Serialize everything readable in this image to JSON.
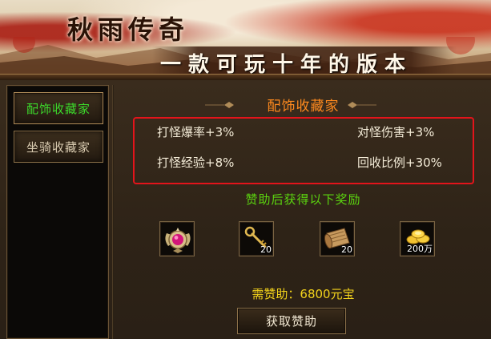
{
  "banner": {
    "title": "秋雨传奇",
    "slogan": "一款可玩十年的版本"
  },
  "sidebar": {
    "items": [
      {
        "label": "配饰收藏家",
        "active": true
      },
      {
        "label": "坐骑收藏家",
        "active": false
      }
    ]
  },
  "panel": {
    "heading": "配饰收藏家",
    "attributes": [
      "打怪爆率+3%",
      "对怪伤害+3%",
      "打怪经验+8%",
      "回收比例+30%"
    ],
    "reward_title": "赞助后获得以下奖励",
    "rewards": [
      {
        "icon": "jeweled-amulet-icon",
        "qty": ""
      },
      {
        "icon": "golden-key-icon",
        "qty": "20"
      },
      {
        "icon": "scroll-icon",
        "qty": "20"
      },
      {
        "icon": "gold-ingots-icon",
        "qty": "200万"
      }
    ],
    "cost_label": "需赞助：",
    "cost_value": "6800元宝",
    "button_label": "获取赞助"
  },
  "colors": {
    "active_tab": "#3cd92b",
    "heading": "#ff8a1e",
    "highlight_border": "#e3141b",
    "reward_title": "#5bd40f",
    "cost": "#f3d31b"
  }
}
